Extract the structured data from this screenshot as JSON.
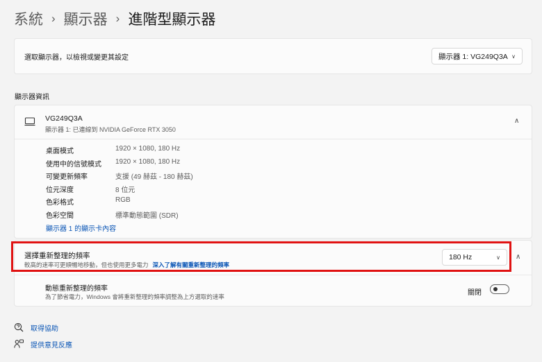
{
  "breadcrumb": {
    "items": [
      "系統",
      "顯示器",
      "進階型顯示器"
    ],
    "separator": "›"
  },
  "display_select": {
    "label": "選取顯示器，以檢視或變更其設定",
    "selected": "顯示器 1: VG249Q3A"
  },
  "section_title": "顯示器資訊",
  "display_info": {
    "name": "VG249Q3A",
    "subtitle": "顯示器 1: 已連線到 NVIDIA GeForce RTX 3050",
    "rows": [
      {
        "key": "桌面模式",
        "value": "1920 × 1080, 180 Hz"
      },
      {
        "key": "使用中的信號模式",
        "value": "1920 × 1080, 180 Hz"
      },
      {
        "key": "可變更新頻率",
        "value": "支援 (49 赫茲 - 180 赫茲)"
      },
      {
        "key": "位元深度",
        "value": "8 位元"
      },
      {
        "key": "色彩格式",
        "value": "RGB"
      },
      {
        "key": "色彩空間",
        "value": "標準動態範圍 (SDR)"
      }
    ],
    "adapter_link": "顯示器 1 的顯示卡內容"
  },
  "refresh_rate": {
    "title": "選擇重新整理的頻率",
    "subtitle": "較高的速率可更順暢地移動，但也使用更多電力",
    "learn_more": "深入了解有關重新整理的頻率",
    "selected": "180 Hz"
  },
  "dynamic_refresh": {
    "title": "動態重新整理的頻率",
    "subtitle": "為了節省電力，Windows 會將重新整理的頻率調整為上方選取的速率",
    "toggle_label": "關閉",
    "toggle_on": false
  },
  "footer": {
    "help": "取得協助",
    "feedback": "提供意見反應"
  },
  "colors": {
    "accent": "#0a55b5",
    "highlight_border": "#e01212",
    "background": "#f3f3f3"
  },
  "icons": [
    "chevron-down-icon",
    "chevron-up-icon",
    "monitor-icon",
    "help-icon",
    "feedback-icon"
  ]
}
